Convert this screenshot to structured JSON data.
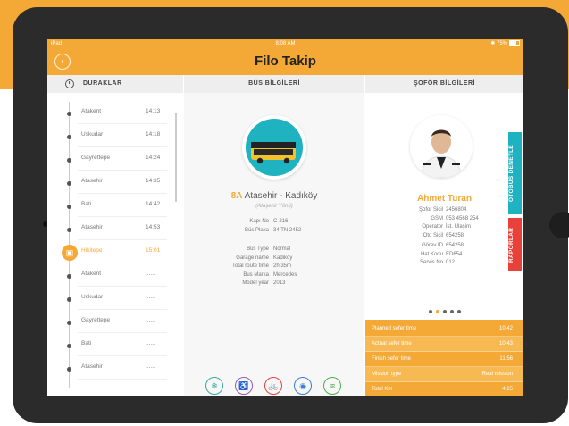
{
  "status": {
    "device": "iPad",
    "time": "8:08 AM",
    "battery": "75%"
  },
  "header": {
    "title": "Filo Takip",
    "back_icon": "back-icon"
  },
  "columns": {
    "stops": "DURAKLAR",
    "bus": "BÜS BİLGİLERİ",
    "driver": "ŞOFÖR BİLGİLERİ"
  },
  "stops": [
    {
      "name": "Atakent",
      "time": "14:13"
    },
    {
      "name": "Uskudar",
      "time": "14:18"
    },
    {
      "name": "Gayrettepe",
      "time": "14:24"
    },
    {
      "name": "Atasehir",
      "time": "14:35"
    },
    {
      "name": "Bati",
      "time": "14:42"
    },
    {
      "name": "Atasehir",
      "time": "14:53"
    },
    {
      "name": "Hikitepe",
      "time": "15:01"
    },
    {
      "name": "Atakent",
      "time": "......"
    },
    {
      "name": "Uskudar",
      "time": "......"
    },
    {
      "name": "Gayrettepe",
      "time": "......"
    },
    {
      "name": "Bati",
      "time": "......"
    },
    {
      "name": "Atasehir",
      "time": "......"
    }
  ],
  "active_stop_index": 6,
  "bus": {
    "route_code": "8A",
    "route_name": "Atasehir - Kadıköy",
    "direction": "(Ataşehir Yönü)",
    "info1": [
      {
        "k": "Kapı No",
        "v": "C-216"
      },
      {
        "k": "Büs Plaka",
        "v": "34 TN 2452"
      }
    ],
    "info2": [
      {
        "k": "Bus Type",
        "v": "Normal"
      },
      {
        "k": "Garage name",
        "v": "Kadiköy"
      },
      {
        "k": "Total route time",
        "v": "2h 35m"
      },
      {
        "k": "Bus Marka",
        "v": "Mercedes"
      },
      {
        "k": "Model year",
        "v": "2013"
      }
    ],
    "features": [
      {
        "label": "Climate",
        "icon": "snowflake-icon",
        "color": "#3aa89a"
      },
      {
        "label": "Engelli Erisimi",
        "icon": "wheelchair-icon",
        "color": "#9b59b6"
      },
      {
        "label": "Bisiklet Tasıma",
        "icon": "bicycle-icon",
        "color": "#e8413a"
      },
      {
        "label": "Camera",
        "icon": "camera-icon",
        "color": "#3b7dd8"
      },
      {
        "label": "Wi-fi",
        "icon": "wifi-icon",
        "color": "#4caf50"
      }
    ]
  },
  "driver": {
    "name": "Ahmet Turan",
    "info1": [
      {
        "k": "Şofor Sicil",
        "v": "2456804"
      },
      {
        "k": "GSM",
        "v": "053 4568 254"
      },
      {
        "k": "Operator",
        "v": "İst. Ulaşim"
      },
      {
        "k": "Oto Sicil",
        "v": "654258"
      }
    ],
    "info2": [
      {
        "k": "Görev ID",
        "v": "654258"
      },
      {
        "k": "Hat Kodu",
        "v": "ED654"
      },
      {
        "k": "Servis No",
        "v": "012"
      }
    ]
  },
  "tabs": {
    "inspect": "OTOBÜS DENETLE",
    "reports": "RAPORLAR"
  },
  "stats": [
    {
      "k": "Planned sefer time",
      "v": "10:42"
    },
    {
      "k": "Actual sefer time",
      "v": "10:43"
    },
    {
      "k": "Finish sefer time",
      "v": "11:56"
    },
    {
      "k": "Mission type",
      "v": "Real mission"
    },
    {
      "k": "Total Km",
      "v": "4.25"
    }
  ],
  "colors": {
    "accent": "#F4A936",
    "teal": "#1fb2c0",
    "red": "#e8413a"
  }
}
